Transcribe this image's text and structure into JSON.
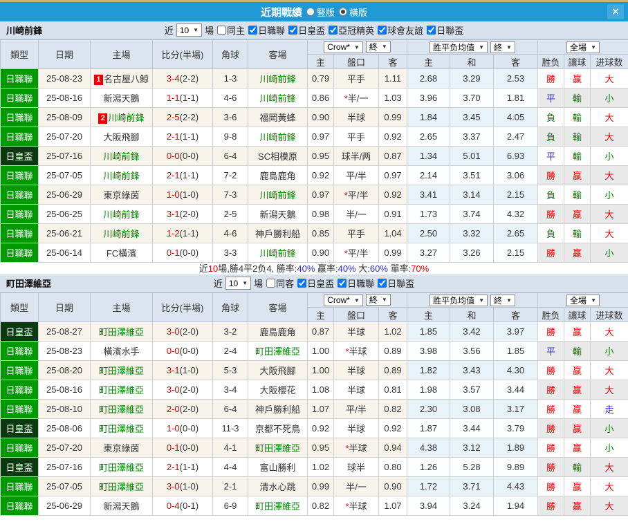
{
  "titlebar": {
    "title": "近期戰績",
    "radio_vertical": "豎版",
    "radio_horizontal": "橫版",
    "selected_layout": "橫版",
    "close_label": "✕"
  },
  "columns": {
    "type": "類型",
    "date": "日期",
    "home": "主場",
    "score": "比分(半場)",
    "corner": "角球",
    "away": "客場",
    "odds_home": "主",
    "handicap": "盤口",
    "odds_away": "客",
    "avg_home": "主",
    "avg_draw": "和",
    "avg_away": "客",
    "result": "胜负",
    "handicap_result": "讓球",
    "goals": "进球数"
  },
  "selects": {
    "crow": "Crow*",
    "final": "終",
    "avg": "胜平负均值",
    "final2": "終",
    "fullmatch": "全場",
    "near_count": "10"
  },
  "filter_labels": {
    "near": "近",
    "games": "場"
  },
  "colors": {
    "titlebar": "#1F99D6",
    "league_green": "#009900",
    "cup_dark_green": "#0C3A10",
    "win_red": "#E60000",
    "draw_blue": "#2A2AD4",
    "lose_green": "#008000"
  },
  "teams": [
    {
      "name": "川崎前鋒",
      "same_checkbox": "同主",
      "same_checked": false,
      "leagues": [
        "日職聯",
        "日皇盃",
        "亞冠精英",
        "球會友誼",
        "日聯盃"
      ],
      "rows": [
        {
          "type": "日職聯",
          "type_style": "green",
          "date": "25-08-23",
          "home": {
            "badge": "1",
            "name": "名古屋八鯨",
            "self": false
          },
          "score": "3-4",
          "half": "(2-2)",
          "corners": "1-3",
          "away": {
            "name": "川崎前鋒",
            "self": true
          },
          "odds_home": "0.79",
          "handicap": "平手",
          "handicap_star": false,
          "odds_away": "1.11",
          "avg_home": "2.68",
          "avg_draw": "3.29",
          "avg_away": "2.53",
          "result": "勝",
          "result_c": "r",
          "hres": "赢",
          "hres_c": "r",
          "goals": "大",
          "goals_c": "r"
        },
        {
          "type": "日職聯",
          "type_style": "green",
          "date": "25-08-16",
          "home": {
            "name": "新潟天鵝",
            "self": false
          },
          "score": "1-1",
          "half": "(1-1)",
          "corners": "4-6",
          "away": {
            "name": "川崎前鋒",
            "self": true
          },
          "odds_home": "0.86",
          "handicap": "半/一",
          "handicap_star": true,
          "odds_away": "1.03",
          "avg_home": "3.96",
          "avg_draw": "3.70",
          "avg_away": "1.81",
          "result": "平",
          "result_c": "b",
          "hres": "輸",
          "hres_c": "g",
          "goals": "小",
          "goals_c": "g"
        },
        {
          "type": "日職聯",
          "type_style": "green",
          "date": "25-08-09",
          "home": {
            "badge": "2",
            "name": "川崎前鋒",
            "self": true
          },
          "score": "2-5",
          "half": "(2-2)",
          "corners": "3-6",
          "away": {
            "name": "福岡黃蜂",
            "self": false
          },
          "odds_home": "0.90",
          "handicap": "半球",
          "handicap_star": false,
          "odds_away": "0.99",
          "avg_home": "1.84",
          "avg_draw": "3.45",
          "avg_away": "4.05",
          "result": "負",
          "result_c": "g",
          "hres": "輸",
          "hres_c": "g",
          "goals": "大",
          "goals_c": "r"
        },
        {
          "type": "日職聯",
          "type_style": "green",
          "date": "25-07-20",
          "home": {
            "name": "大阪飛腳",
            "self": false
          },
          "score": "2-1",
          "half": "(1-1)",
          "corners": "9-8",
          "away": {
            "name": "川崎前鋒",
            "self": true
          },
          "odds_home": "0.97",
          "handicap": "平手",
          "handicap_star": false,
          "odds_away": "0.92",
          "avg_home": "2.65",
          "avg_draw": "3.37",
          "avg_away": "2.47",
          "result": "負",
          "result_c": "g",
          "hres": "輸",
          "hres_c": "g",
          "goals": "大",
          "goals_c": "r"
        },
        {
          "type": "日皇盃",
          "type_style": "dark",
          "date": "25-07-16",
          "home": {
            "name": "川崎前鋒",
            "self": true
          },
          "score": "0-0",
          "half": "(0-0)",
          "corners": "6-4",
          "away": {
            "name": "SC相模原",
            "self": false
          },
          "odds_home": "0.95",
          "handicap": "球半/两",
          "handicap_star": false,
          "odds_away": "0.87",
          "avg_home": "1.34",
          "avg_draw": "5.01",
          "avg_away": "6.93",
          "result": "平",
          "result_c": "b",
          "hres": "輸",
          "hres_c": "g",
          "goals": "小",
          "goals_c": "g"
        },
        {
          "type": "日職聯",
          "type_style": "green",
          "date": "25-07-05",
          "home": {
            "name": "川崎前鋒",
            "self": true
          },
          "score": "2-1",
          "half": "(1-1)",
          "corners": "7-2",
          "away": {
            "name": "鹿島鹿角",
            "self": false
          },
          "odds_home": "0.92",
          "handicap": "平/半",
          "handicap_star": false,
          "odds_away": "0.97",
          "avg_home": "2.14",
          "avg_draw": "3.51",
          "avg_away": "3.06",
          "result": "勝",
          "result_c": "r",
          "hres": "赢",
          "hres_c": "r",
          "goals": "大",
          "goals_c": "r"
        },
        {
          "type": "日職聯",
          "type_style": "green",
          "date": "25-06-29",
          "home": {
            "name": "東京綠茵",
            "self": false
          },
          "score": "1-0",
          "half": "(1-0)",
          "corners": "7-3",
          "away": {
            "name": "川崎前鋒",
            "self": true
          },
          "odds_home": "0.97",
          "handicap": "平/半",
          "handicap_star": true,
          "odds_away": "0.92",
          "avg_home": "3.41",
          "avg_draw": "3.14",
          "avg_away": "2.15",
          "result": "負",
          "result_c": "g",
          "hres": "輸",
          "hres_c": "g",
          "goals": "小",
          "goals_c": "g"
        },
        {
          "type": "日職聯",
          "type_style": "green",
          "date": "25-06-25",
          "home": {
            "name": "川崎前鋒",
            "self": true
          },
          "score": "3-1",
          "half": "(2-0)",
          "corners": "2-5",
          "away": {
            "name": "新潟天鵝",
            "self": false
          },
          "odds_home": "0.98",
          "handicap": "半/一",
          "handicap_star": false,
          "odds_away": "0.91",
          "avg_home": "1.73",
          "avg_draw": "3.74",
          "avg_away": "4.32",
          "result": "勝",
          "result_c": "r",
          "hres": "赢",
          "hres_c": "r",
          "goals": "大",
          "goals_c": "r"
        },
        {
          "type": "日職聯",
          "type_style": "green",
          "date": "25-06-21",
          "home": {
            "name": "川崎前鋒",
            "self": true
          },
          "score": "1-2",
          "half": "(1-1)",
          "corners": "4-6",
          "away": {
            "name": "神戶勝利船",
            "self": false
          },
          "odds_home": "0.85",
          "handicap": "平手",
          "handicap_star": false,
          "odds_away": "1.04",
          "avg_home": "2.50",
          "avg_draw": "3.32",
          "avg_away": "2.65",
          "result": "負",
          "result_c": "g",
          "hres": "輸",
          "hres_c": "g",
          "goals": "大",
          "goals_c": "r"
        },
        {
          "type": "日職聯",
          "type_style": "green",
          "date": "25-06-14",
          "home": {
            "name": "FC橫濱",
            "self": false
          },
          "score": "0-1",
          "half": "(0-0)",
          "corners": "3-3",
          "away": {
            "name": "川崎前鋒",
            "self": true
          },
          "odds_home": "0.90",
          "handicap": "平/半",
          "handicap_star": true,
          "odds_away": "0.99",
          "avg_home": "3.27",
          "avg_draw": "3.26",
          "avg_away": "2.15",
          "result": "勝",
          "result_c": "r",
          "hres": "赢",
          "hres_c": "r",
          "goals": "小",
          "goals_c": "g"
        }
      ],
      "summary": [
        {
          "t": "近",
          "c": "k"
        },
        {
          "t": "10",
          "c": "r"
        },
        {
          "t": "場,勝4平2负4, 勝率:",
          "c": "k"
        },
        {
          "t": "40%",
          "c": "b"
        },
        {
          "t": " 赢率:",
          "c": "k"
        },
        {
          "t": "40%",
          "c": "b"
        },
        {
          "t": " 大:",
          "c": "k"
        },
        {
          "t": "60%",
          "c": "b"
        },
        {
          "t": " 單率:",
          "c": "k"
        },
        {
          "t": "70%",
          "c": "r"
        }
      ]
    },
    {
      "name": "町田澤維亞",
      "same_checkbox": "同客",
      "same_checked": false,
      "leagues": [
        "日皇盃",
        "日職聯",
        "日聯盃"
      ],
      "rows": [
        {
          "type": "日皇盃",
          "type_style": "dark",
          "date": "25-08-27",
          "home": {
            "name": "町田澤維亞",
            "self": true
          },
          "score": "3-0",
          "half": "(2-0)",
          "corners": "3-2",
          "away": {
            "name": "鹿島鹿角",
            "self": false
          },
          "odds_home": "0.87",
          "handicap": "半球",
          "handicap_star": false,
          "odds_away": "1.02",
          "avg_home": "1.85",
          "avg_draw": "3.42",
          "avg_away": "3.97",
          "result": "勝",
          "result_c": "r",
          "hres": "赢",
          "hres_c": "r",
          "goals": "大",
          "goals_c": "r"
        },
        {
          "type": "日職聯",
          "type_style": "green",
          "date": "25-08-23",
          "home": {
            "name": "橫濱水手",
            "self": false
          },
          "score": "0-0",
          "half": "(0-0)",
          "corners": "2-4",
          "away": {
            "name": "町田澤維亞",
            "self": true
          },
          "odds_home": "1.00",
          "handicap": "半球",
          "handicap_star": true,
          "odds_away": "0.89",
          "avg_home": "3.98",
          "avg_draw": "3.56",
          "avg_away": "1.85",
          "result": "平",
          "result_c": "b",
          "hres": "輸",
          "hres_c": "g",
          "goals": "小",
          "goals_c": "g"
        },
        {
          "type": "日職聯",
          "type_style": "green",
          "date": "25-08-20",
          "home": {
            "name": "町田澤維亞",
            "self": true
          },
          "score": "3-1",
          "half": "(1-0)",
          "corners": "5-3",
          "away": {
            "name": "大阪飛腳",
            "self": false
          },
          "odds_home": "1.00",
          "handicap": "半球",
          "handicap_star": false,
          "odds_away": "0.89",
          "avg_home": "1.82",
          "avg_draw": "3.43",
          "avg_away": "4.30",
          "result": "勝",
          "result_c": "r",
          "hres": "赢",
          "hres_c": "r",
          "goals": "大",
          "goals_c": "r"
        },
        {
          "type": "日職聯",
          "type_style": "green",
          "date": "25-08-16",
          "home": {
            "name": "町田澤維亞",
            "self": true
          },
          "score": "3-0",
          "half": "(2-0)",
          "corners": "3-4",
          "away": {
            "name": "大阪櫻花",
            "self": false
          },
          "odds_home": "1.08",
          "handicap": "半球",
          "handicap_star": false,
          "odds_away": "0.81",
          "avg_home": "1.98",
          "avg_draw": "3.57",
          "avg_away": "3.44",
          "result": "勝",
          "result_c": "r",
          "hres": "赢",
          "hres_c": "r",
          "goals": "大",
          "goals_c": "r"
        },
        {
          "type": "日職聯",
          "type_style": "green",
          "date": "25-08-10",
          "home": {
            "name": "町田澤維亞",
            "self": true
          },
          "score": "2-0",
          "half": "(2-0)",
          "corners": "6-4",
          "away": {
            "name": "神戶勝利船",
            "self": false
          },
          "odds_home": "1.07",
          "handicap": "平/半",
          "handicap_star": false,
          "odds_away": "0.82",
          "avg_home": "2.30",
          "avg_draw": "3.08",
          "avg_away": "3.17",
          "result": "勝",
          "result_c": "r",
          "hres": "赢",
          "hres_c": "r",
          "goals": "走",
          "goals_c": "b"
        },
        {
          "type": "日皇盃",
          "type_style": "dark",
          "date": "25-08-06",
          "home": {
            "name": "町田澤維亞",
            "self": true
          },
          "score": "1-0",
          "half": "(0-0)",
          "corners": "11-3",
          "away": {
            "name": "京都不死鳥",
            "self": false
          },
          "odds_home": "0.92",
          "handicap": "半球",
          "handicap_star": false,
          "odds_away": "0.92",
          "avg_home": "1.87",
          "avg_draw": "3.44",
          "avg_away": "3.79",
          "result": "勝",
          "result_c": "r",
          "hres": "赢",
          "hres_c": "r",
          "goals": "小",
          "goals_c": "g"
        },
        {
          "type": "日職聯",
          "type_style": "green",
          "date": "25-07-20",
          "home": {
            "name": "東京綠茵",
            "self": false
          },
          "score": "0-1",
          "half": "(0-0)",
          "corners": "4-1",
          "away": {
            "name": "町田澤維亞",
            "self": true
          },
          "odds_home": "0.95",
          "handicap": "半球",
          "handicap_star": true,
          "odds_away": "0.94",
          "avg_home": "4.38",
          "avg_draw": "3.12",
          "avg_away": "1.89",
          "result": "勝",
          "result_c": "r",
          "hres": "赢",
          "hres_c": "r",
          "goals": "小",
          "goals_c": "g"
        },
        {
          "type": "日皇盃",
          "type_style": "dark",
          "date": "25-07-16",
          "home": {
            "name": "町田澤維亞",
            "self": true
          },
          "score": "2-1",
          "half": "(1-1)",
          "corners": "4-4",
          "away": {
            "name": "富山勝利",
            "self": false
          },
          "odds_home": "1.02",
          "handicap": "球半",
          "handicap_star": false,
          "odds_away": "0.80",
          "avg_home": "1.26",
          "avg_draw": "5.28",
          "avg_away": "9.89",
          "result": "勝",
          "result_c": "r",
          "hres": "輸",
          "hres_c": "g",
          "goals": "大",
          "goals_c": "r"
        },
        {
          "type": "日職聯",
          "type_style": "green",
          "date": "25-07-05",
          "home": {
            "name": "町田澤維亞",
            "self": true
          },
          "score": "3-0",
          "half": "(1-0)",
          "corners": "2-1",
          "away": {
            "name": "清水心跳",
            "self": false
          },
          "odds_home": "0.99",
          "handicap": "半/一",
          "handicap_star": false,
          "odds_away": "0.90",
          "avg_home": "1.72",
          "avg_draw": "3.71",
          "avg_away": "4.43",
          "result": "勝",
          "result_c": "r",
          "hres": "赢",
          "hres_c": "r",
          "goals": "大",
          "goals_c": "r"
        },
        {
          "type": "日職聯",
          "type_style": "green",
          "date": "25-06-29",
          "home": {
            "name": "新潟天鵝",
            "self": false
          },
          "score": "0-4",
          "half": "(0-1)",
          "corners": "6-9",
          "away": {
            "name": "町田澤維亞",
            "self": true
          },
          "odds_home": "0.82",
          "handicap": "半球",
          "handicap_star": true,
          "odds_away": "1.07",
          "avg_home": "3.94",
          "avg_draw": "3.24",
          "avg_away": "1.94",
          "result": "勝",
          "result_c": "r",
          "hres": "赢",
          "hres_c": "r",
          "goals": "大",
          "goals_c": "r"
        }
      ]
    }
  ]
}
